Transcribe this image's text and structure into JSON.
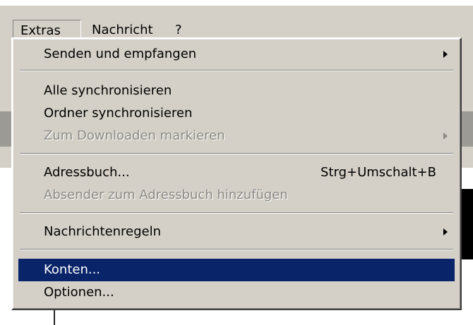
{
  "menubar": {
    "items": [
      {
        "label": "Extras"
      },
      {
        "label": "Nachricht"
      },
      {
        "label": "?"
      }
    ]
  },
  "menu": {
    "items": [
      {
        "label": "Senden und empfangen",
        "submenu": true
      },
      {
        "label": "Alle synchronisieren"
      },
      {
        "label": "Ordner synchronisieren"
      },
      {
        "label": "Zum Downloaden markieren",
        "disabled": true,
        "submenu": true
      },
      {
        "label": "Adressbuch...",
        "shortcut": "Strg+Umschalt+B"
      },
      {
        "label": "Absender zum Adressbuch hinzufügen",
        "disabled": true
      },
      {
        "label": "Nachrichtenregeln",
        "submenu": true
      },
      {
        "label": "Konten...",
        "selected": true
      },
      {
        "label": "Optionen..."
      }
    ]
  },
  "colors": {
    "menu_bg": "#d4d0c8",
    "selection": "#0a246a",
    "disabled_text": "#8c8a85"
  }
}
